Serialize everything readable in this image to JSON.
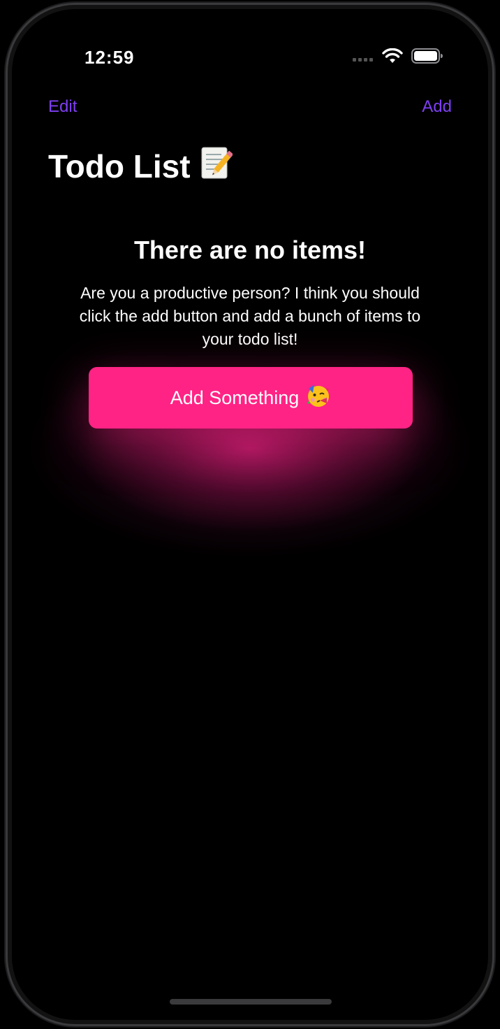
{
  "status_bar": {
    "time": "12:59",
    "icons": [
      "signal-icon",
      "wifi-icon",
      "battery-icon"
    ]
  },
  "nav": {
    "edit_label": "Edit",
    "add_label": "Add"
  },
  "page": {
    "title": "Todo List",
    "title_icon": "memo-icon"
  },
  "empty_state": {
    "title": "There are no items!",
    "message": "Are you a productive person? I think you should click the add button and add a bunch of items to your todo list!",
    "button_label": "Add Something",
    "button_icon": "partying-face-icon"
  },
  "colors": {
    "accent": "#7e3ff2",
    "button": "#ff2385",
    "background": "#000000"
  }
}
